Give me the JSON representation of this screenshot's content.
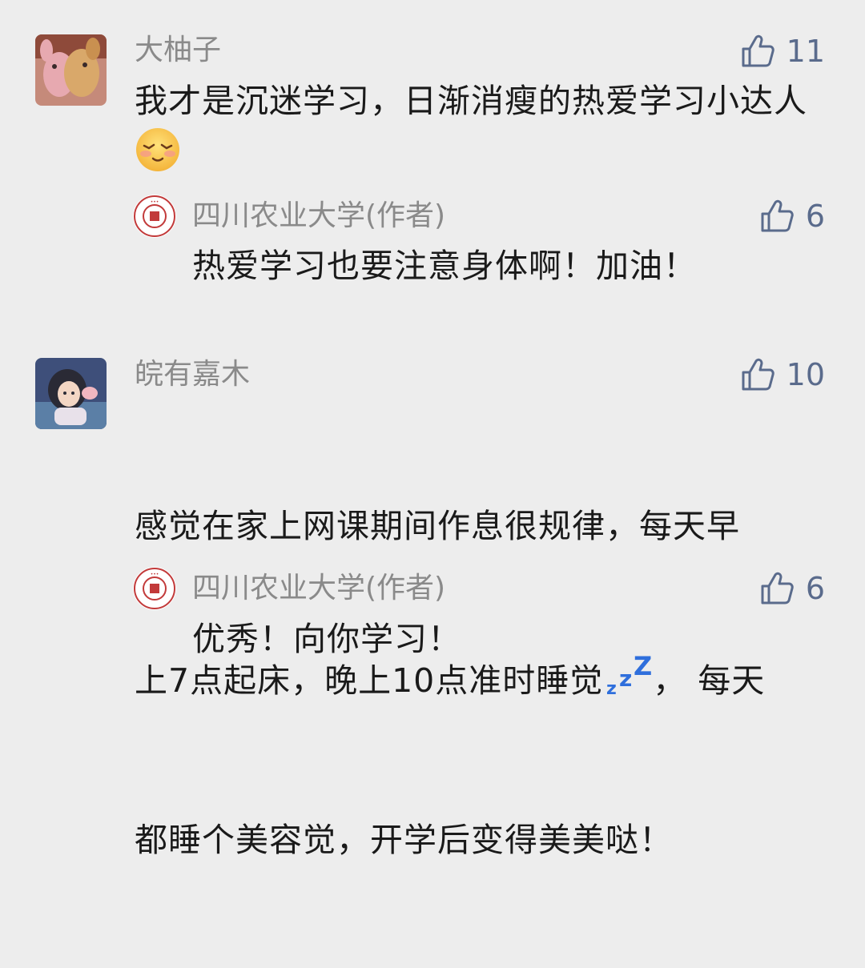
{
  "comments": [
    {
      "author": "大柚子",
      "likes": "11",
      "text": "我才是沉迷学习，日渐消瘦的热爱学习小达人",
      "emoji_icon": "shy-smile-emoji",
      "reply": {
        "author": "四川农业大学(作者)",
        "likes": "6",
        "text": "热爱学习也要注意身体啊！加油！"
      }
    },
    {
      "author": "皖有嘉木",
      "likes": "10",
      "text_line1": "感觉在家上网课期间作息很规律，每天早",
      "text_line2a": "上7点起床，晚上10点准时睡觉",
      "text_line2b": "，  每天",
      "text_line3": "都睡个美容觉，开学后变得美美哒！",
      "emoji_icon": "zzz-sleep-emoji",
      "reply": {
        "author": "四川农业大学(作者)",
        "likes": "6",
        "text": "优秀！向你学习！"
      }
    }
  ],
  "colors": {
    "background": "#ededed",
    "name_gray": "#8a8a8a",
    "like_blue_gray": "#5a6b8c",
    "zzz_blue": "#2f6fdc"
  }
}
